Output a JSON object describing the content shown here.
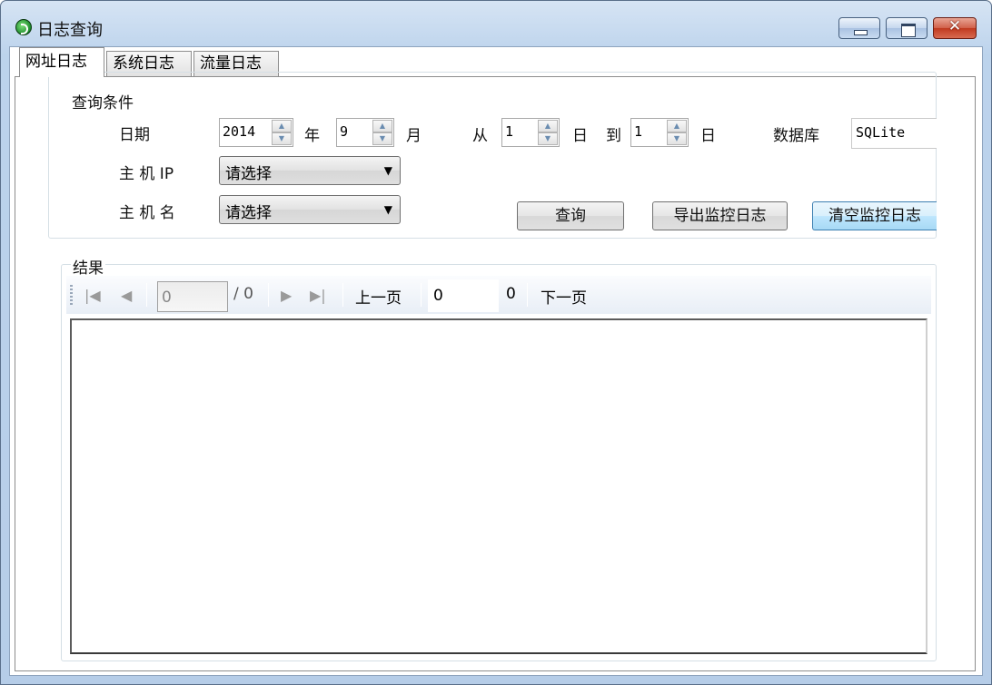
{
  "window": {
    "title": "日志查询"
  },
  "tabs": [
    "网址日志",
    "系统日志",
    "流量日志"
  ],
  "query_group": {
    "legend": "查询条件",
    "date_label": "日期",
    "year_value": "2014",
    "year_unit": "年",
    "month_value": "9",
    "month_unit": "月",
    "from_label": "从",
    "from_day_value": "1",
    "from_day_unit": "日",
    "to_label": "到",
    "to_day_value": "1",
    "to_day_unit": "日",
    "database_label": "数据库",
    "database_value": "SQLite",
    "host_ip_label": "主 机 IP",
    "host_ip_selected": "请选择",
    "host_name_label": "主 机 名",
    "host_name_selected": "请选择",
    "buttons": {
      "query": "查询",
      "export": "导出监控日志",
      "clear": "清空监控日志"
    }
  },
  "results_group": {
    "legend": "结果",
    "pager": {
      "current_page": "0",
      "total_pages": "/ 0",
      "prev_label": "上一页",
      "page_box_value": "0",
      "count_value": "0",
      "next_label": "下一页"
    }
  },
  "icons": {
    "first": "first-page-icon",
    "prev": "prev-page-icon",
    "next": "next-page-icon",
    "last": "last-page-icon"
  }
}
